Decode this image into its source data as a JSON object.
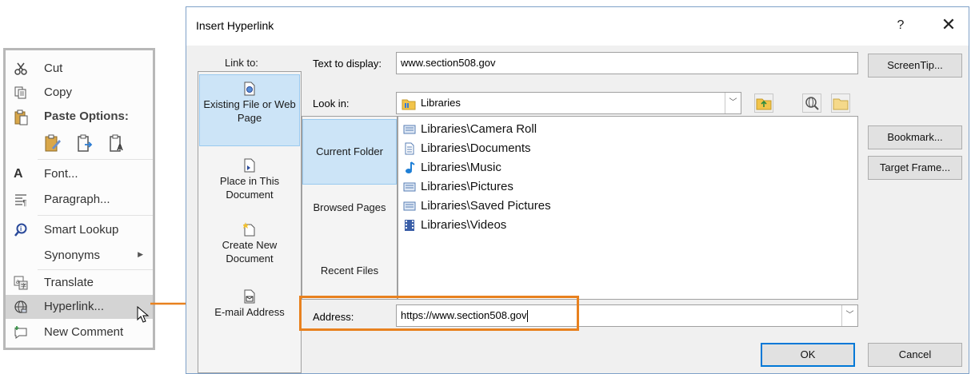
{
  "context_menu": {
    "items": [
      {
        "label": "Cut",
        "icon": "scissors-icon"
      },
      {
        "label": "Copy",
        "icon": "copy-icon"
      },
      {
        "label": "Paste Options:",
        "icon": "paste-icon"
      },
      {
        "label": "Font...",
        "icon": "font-icon"
      },
      {
        "label": "Paragraph...",
        "icon": "paragraph-icon"
      },
      {
        "label": "Smart Lookup",
        "icon": "smart-lookup-icon"
      },
      {
        "label": "Synonyms",
        "icon": ""
      },
      {
        "label": "Translate",
        "icon": "translate-icon"
      },
      {
        "label": "Hyperlink...",
        "icon": "hyperlink-icon"
      },
      {
        "label": "New Comment",
        "icon": "new-comment-icon"
      }
    ]
  },
  "dialog": {
    "title": "Insert Hyperlink",
    "help": "?",
    "close": "✕",
    "link_to_label": "Link to:",
    "link_to_items": [
      {
        "label": "Existing File or Web Page",
        "selected": true
      },
      {
        "label": "Place in This Document",
        "selected": false
      },
      {
        "label": "Create New Document",
        "selected": false
      },
      {
        "label": "E-mail Address",
        "selected": false
      }
    ],
    "text_to_display_label": "Text to display:",
    "text_to_display_value": "www.section508.gov",
    "screentip_label": "ScreenTip...",
    "look_in_label": "Look in:",
    "look_in_value": "Libraries",
    "nav_items": [
      {
        "label": "Current Folder",
        "selected": true
      },
      {
        "label": "Browsed Pages",
        "selected": false
      },
      {
        "label": "Recent Files",
        "selected": false
      }
    ],
    "files": [
      "Libraries\\Camera Roll",
      "Libraries\\Documents",
      "Libraries\\Music",
      "Libraries\\Pictures",
      "Libraries\\Saved Pictures",
      "Libraries\\Videos"
    ],
    "bookmark_label": "Bookmark...",
    "target_frame_label": "Target Frame...",
    "address_label": "Address:",
    "address_value": "https://www.section508.gov",
    "ok_label": "OK",
    "cancel_label": "Cancel"
  },
  "colors": {
    "highlight_orange": "#e8811f",
    "selection_blue": "#cce4f7"
  }
}
